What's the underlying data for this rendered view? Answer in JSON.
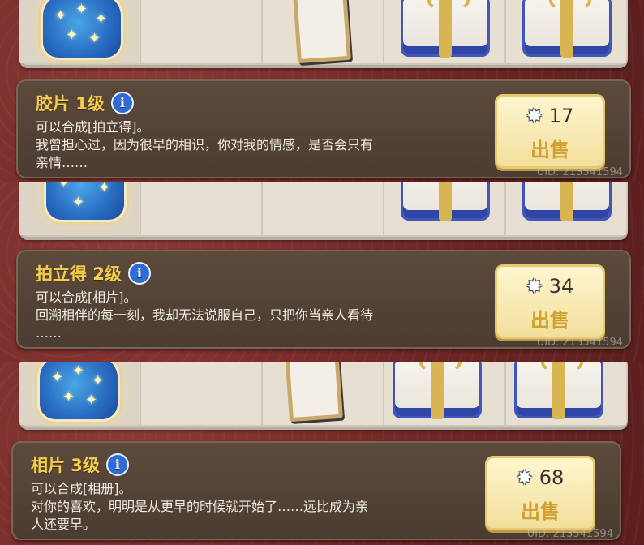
{
  "items": [
    {
      "title": "胶片 1级",
      "desc_lines": [
        "可以合成[拍立得]。",
        "我曾担心过，因为很早的相识，你对我的情感，是否会只有",
        "亲情……"
      ],
      "price": "17",
      "sell_label": "出售",
      "uid": "UID: 213541594"
    },
    {
      "title": "拍立得 2级",
      "desc_lines": [
        "可以合成[相片]。",
        "回溯相伴的每一刻，我却无法说服自己，只把你当亲人看待",
        "……"
      ],
      "price": "34",
      "sell_label": "出售",
      "uid": "UID: 213541594"
    },
    {
      "title": "相片 3级",
      "desc_lines": [
        "可以合成[相册]。",
        "对你的喜欢，明明是从更早的时候就开始了……远比成为亲",
        "人还要早。"
      ],
      "price": "68",
      "sell_label": "出售",
      "uid": "UID: 213541594"
    }
  ],
  "icons": {
    "info": "info-icon",
    "star": "star-currency-icon",
    "bottle": "star-bottle-icon",
    "frame": "photo-frame-icon",
    "gift": "gift-box-icon"
  },
  "colors": {
    "title": "#f5cf4a",
    "card_bg": "#4b3c31",
    "sell_button": "#fff6cf",
    "sell_text": "#d0a032",
    "info_icon": "#2e6bd6"
  }
}
